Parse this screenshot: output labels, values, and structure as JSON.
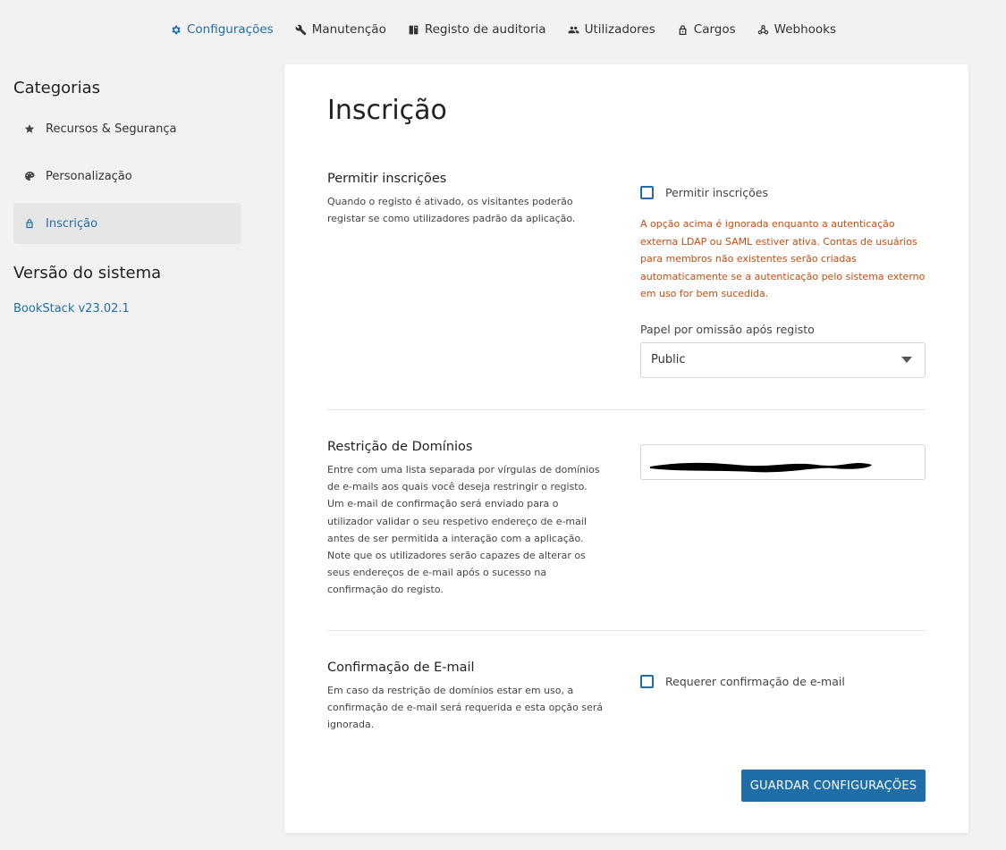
{
  "nav": {
    "items": [
      {
        "label": "Configurações",
        "icon": "gear-icon",
        "active": true
      },
      {
        "label": "Manutenção",
        "icon": "wrench-icon"
      },
      {
        "label": "Registo de auditoria",
        "icon": "book-icon"
      },
      {
        "label": "Utilizadores",
        "icon": "users-icon"
      },
      {
        "label": "Cargos",
        "icon": "lock-icon"
      },
      {
        "label": "Webhooks",
        "icon": "webhook-icon"
      }
    ]
  },
  "sidebar": {
    "categories_title": "Categorias",
    "items": [
      {
        "label": "Recursos & Segurança",
        "icon": "star-icon"
      },
      {
        "label": "Personalização",
        "icon": "palette-icon"
      },
      {
        "label": "Inscrição",
        "icon": "lock-icon",
        "active": true
      }
    ],
    "version_title": "Versão do sistema",
    "version_link": "BookStack v23.02.1"
  },
  "page": {
    "title": "Inscrição",
    "registration": {
      "title": "Permitir inscrições",
      "desc": "Quando o registo é ativado, os visitantes poderão registar se como utilizadores padrão da aplicação.",
      "checkbox_label": "Permitir inscrições",
      "warning": "A opção acima é ignorada enquanto a autenticação externa LDAP ou SAML estiver ativa. Contas de usuários para membros não existentes serão criadas automaticamente se a autenticação pelo sistema externo em uso for bem sucedida.",
      "role_label": "Papel por omissão após registo",
      "role_value": "Public"
    },
    "domains": {
      "title": "Restrição de Domínios",
      "desc1": "Entre com uma lista separada por vírgulas de domínios de e-mails aos quais você deseja restringir o registo. Um e-mail de confirmação será enviado para o utilizador validar o seu respetivo endereço de e-mail antes de ser permitida a interação com a aplicação.",
      "desc2": "Note que os utilizadores serão capazes de alterar os seus endereços de e-mail após o sucesso na confirmação do registo."
    },
    "email_confirm": {
      "title": "Confirmação de E-mail",
      "desc": "Em caso da restrição de domínios estar em uso, a confirmação de e-mail será requerida e esta opção será ignorada.",
      "checkbox_label": "Requerer confirmação de e-mail"
    },
    "save_label": "GUARDAR CONFIGURAÇÕES"
  },
  "colors": {
    "accent": "#206ea7",
    "warning": "#c84d0f",
    "background": "#f2f2f2"
  }
}
